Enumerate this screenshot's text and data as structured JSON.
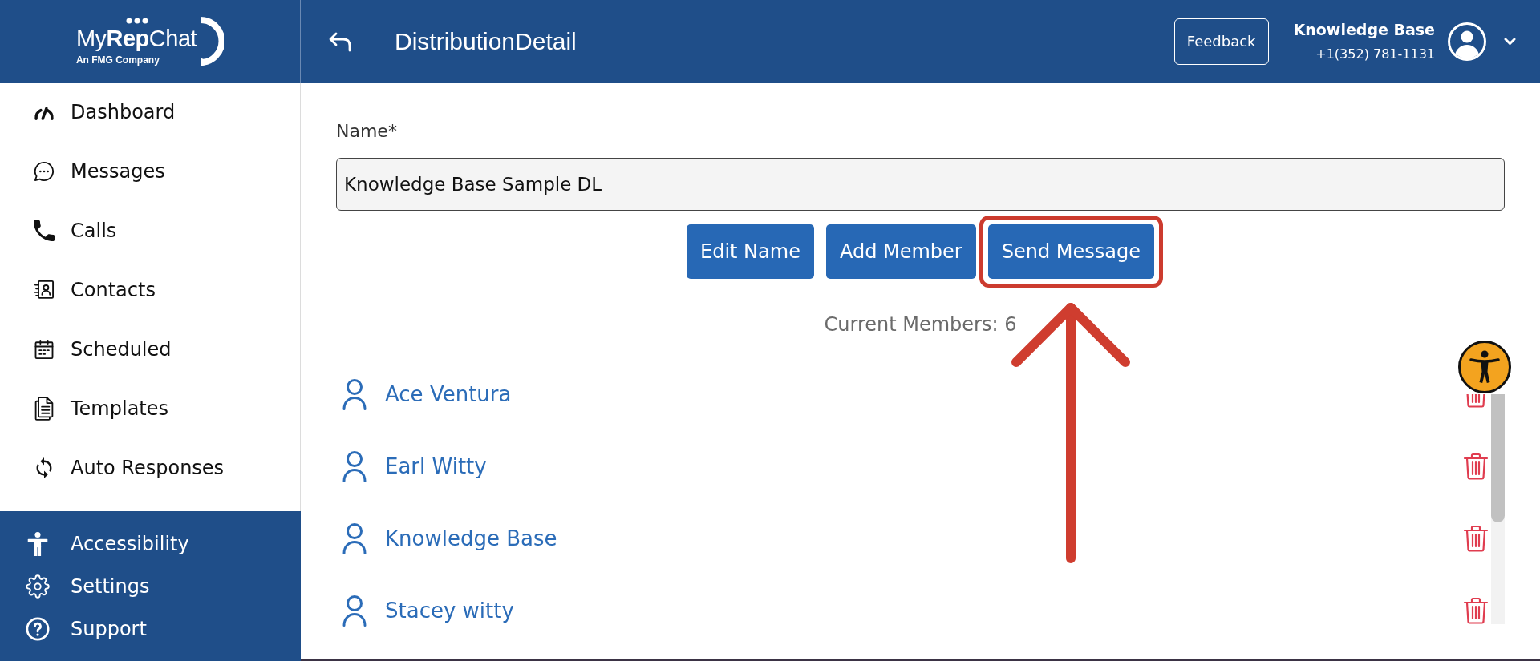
{
  "logo": {
    "wordmark": "My**Rep**Chat",
    "tagline": "An FMG Company"
  },
  "header": {
    "title": "DistributionDetail",
    "feedback_button": "Feedback",
    "user": {
      "name": "Knowledge Base",
      "phone": "+1(352) 781-1131"
    }
  },
  "sidebar": {
    "items": [
      {
        "label": "Dashboard"
      },
      {
        "label": "Messages"
      },
      {
        "label": "Calls"
      },
      {
        "label": "Contacts"
      },
      {
        "label": "Scheduled"
      },
      {
        "label": "Templates"
      },
      {
        "label": "Auto Responses"
      }
    ],
    "footer_items": [
      {
        "label": "Accessibility"
      },
      {
        "label": "Settings"
      },
      {
        "label": "Support"
      }
    ]
  },
  "name_field": {
    "label": "Name*",
    "value": "Knowledge Base Sample DL"
  },
  "buttons": [
    {
      "label": "Edit Name",
      "highlighted": false
    },
    {
      "label": "Add Member",
      "highlighted": false
    },
    {
      "label": "Send Message",
      "highlighted": true
    }
  ],
  "members_count": "Current Members: 6",
  "members": [
    {
      "name": "Ace Ventura"
    },
    {
      "name": "Earl Witty"
    },
    {
      "name": "Knowledge Base"
    },
    {
      "name": "Stacey witty"
    }
  ]
}
